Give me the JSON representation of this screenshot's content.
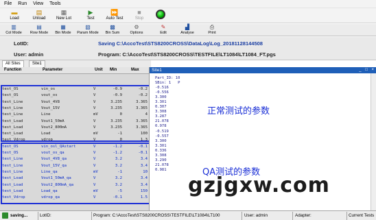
{
  "menu": [
    "File",
    "Run",
    "View",
    "Tools"
  ],
  "toolbar": {
    "load": "Load",
    "unload": "Unload",
    "new_lot": "New Lot",
    "test": "Test",
    "auto_test": "Auto Test",
    "stop": "Stop"
  },
  "toolbar2": {
    "col_mode": "Col Mode",
    "row_mode": "Row Mode",
    "bin_mode": "Bin Mode",
    "param_mode": "Param Mode",
    "bin_sum": "Bin Sum",
    "options": "Options",
    "edit": "Edit",
    "analyse": "Analyse",
    "print": "Print"
  },
  "info": {
    "lot_label": "LotID:",
    "user_label": "User: admin",
    "saving": "Saving C:\\AccoTest\\STS8200CROSS\\DataLog\\Log_20181128144508",
    "program": "Program: C:\\AccoTest\\STS8200CROSS\\TESTFILE\\LT1084\\LT1084_FT.pgs"
  },
  "tabs": [
    "All Sites",
    "Site1"
  ],
  "grid": {
    "headers": [
      "Function",
      "Parameter",
      "Unit",
      "Min",
      "Max"
    ],
    "rows": [
      {
        "func": "test_OS",
        "param": "vin_os",
        "unit": "V",
        "min": "-0.9",
        "max": "-0.2",
        "type": "norm"
      },
      {
        "func": "test_OS",
        "param": "vout_os",
        "unit": "V",
        "min": "-0.9",
        "max": "-0.2",
        "type": "norm"
      },
      {
        "func": "test_Line",
        "param": "Vout_4V8",
        "unit": "V",
        "min": "3.235",
        "max": "3.365",
        "type": "norm"
      },
      {
        "func": "test_Line",
        "param": "Vout_15V",
        "unit": "V",
        "min": "3.235",
        "max": "3.365",
        "type": "norm"
      },
      {
        "func": "test_Line",
        "param": "Line",
        "unit": "mV",
        "min": "0",
        "max": "4",
        "type": "norm"
      },
      {
        "func": "test_Load",
        "param": "Vout1_50mA",
        "unit": "V",
        "min": "3.235",
        "max": "3.365",
        "type": "norm"
      },
      {
        "func": "test_Load",
        "param": "Vout2_800mA",
        "unit": "V",
        "min": "3.235",
        "max": "3.365",
        "type": "norm"
      },
      {
        "func": "test_Load",
        "param": "Load",
        "unit": "mV",
        "min": "-1",
        "max": "100",
        "type": "norm"
      },
      {
        "func": "test_Vdrop",
        "param": "vdrop",
        "unit": "V",
        "min": "0",
        "max": "1.3",
        "type": "norm"
      },
      {
        "func": "test_OS",
        "param": "vin_osl_QAstart",
        "unit": "V",
        "min": "-1.2",
        "max": "-0.1",
        "type": "qa"
      },
      {
        "func": "test_OS",
        "param": "vout_os_qa",
        "unit": "V",
        "min": "-1.2",
        "max": "-0.1",
        "type": "qa"
      },
      {
        "func": "test_Line",
        "param": "Vout_4V8_qa",
        "unit": "V",
        "min": "3.2",
        "max": "3.4",
        "type": "qa"
      },
      {
        "func": "test_Line",
        "param": "Vout_15V_qa",
        "unit": "V",
        "min": "3.2",
        "max": "3.4",
        "type": "qa"
      },
      {
        "func": "test_Line",
        "param": "Line_qa",
        "unit": "mV",
        "min": "-1",
        "max": "10",
        "type": "qa"
      },
      {
        "func": "test_Load",
        "param": "Vout1_50mA_qa",
        "unit": "V",
        "min": "3.2",
        "max": "3.4",
        "type": "qa"
      },
      {
        "func": "test_Load",
        "param": "Vout2_800mA_qa",
        "unit": "V",
        "min": "3.2",
        "max": "3.4",
        "type": "qa"
      },
      {
        "func": "test_Load",
        "param": "Load_qa",
        "unit": "mV",
        "min": "-5",
        "max": "150",
        "type": "qa"
      },
      {
        "func": "test_Vdrop",
        "param": "vdrop_qa",
        "unit": "V",
        "min": "-0.1",
        "max": "1.5",
        "type": "qa"
      }
    ]
  },
  "site": {
    "title": "Site1",
    "part_id": "Part_ID: 10",
    "sbin": "SBin: 1   P",
    "values": [
      "-0.516",
      "-0.556",
      "3.300",
      "3.301",
      "0.307",
      "3.308",
      "3.287",
      "21.078",
      "0.978",
      "-0.519",
      "-0.557",
      "3.300",
      "3.301",
      "0.336",
      "3.308",
      "3.290",
      "21.078",
      "0.981"
    ]
  },
  "notes": {
    "normal": "正常测试的参数",
    "qa": "QA测试的参数"
  },
  "watermark": "gzjgxw.com",
  "status": {
    "saving": "saving...",
    "lot": "LotID:",
    "program": "Program: C:\\AccoTest\\STS8200CROSS\\TESTFILE\\LT1084\\LT100",
    "user": "User: admin",
    "adapter": "Adapter:",
    "current": "Current Tests"
  },
  "colors": {
    "accent_blue": "#1c2fd6",
    "title_bar": "#1f5fb8",
    "status_green": "#00b000"
  }
}
